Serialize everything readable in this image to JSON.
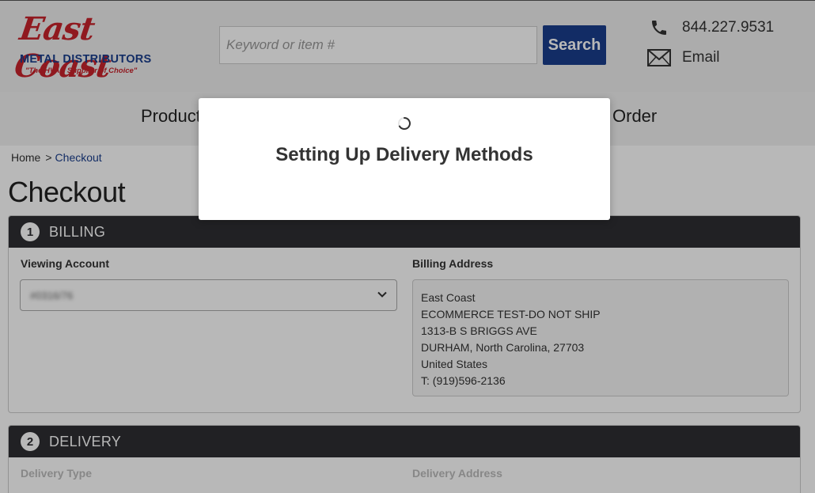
{
  "brand": {
    "script": "East Coast",
    "name": "METAL DISTRIBUTORS",
    "tagline": "\"The HVAC Supplier of Choice\"",
    "primary_color": "#1a3e8c",
    "accent_color": "#c8232c"
  },
  "search": {
    "placeholder": "Keyword or item #",
    "button_label": "Search"
  },
  "contact": {
    "phone": "844.227.9531",
    "email_label": "Email",
    "phone_icon": "phone-icon",
    "email_icon": "envelope-icon"
  },
  "nav": {
    "left_partial": "Product",
    "right_partial": "Order"
  },
  "breadcrumb": {
    "home": "Home",
    "separator": ">",
    "current": "Checkout"
  },
  "page": {
    "title": "Checkout"
  },
  "billing": {
    "step": "1",
    "title": "BILLING",
    "account_label": "Viewing Account",
    "account_value": "#0316/76",
    "address_label": "Billing Address",
    "address": [
      "East Coast",
      "ECOMMERCE TEST-DO NOT SHIP",
      "1313-B S BRIGGS AVE",
      "DURHAM, North Carolina, 27703",
      "United States",
      "T: (919)596-2136"
    ]
  },
  "delivery": {
    "step": "2",
    "title": "DELIVERY",
    "type_label": "Delivery Type",
    "address_label": "Delivery Address"
  },
  "modal": {
    "message": "Setting Up Delivery Methods"
  }
}
